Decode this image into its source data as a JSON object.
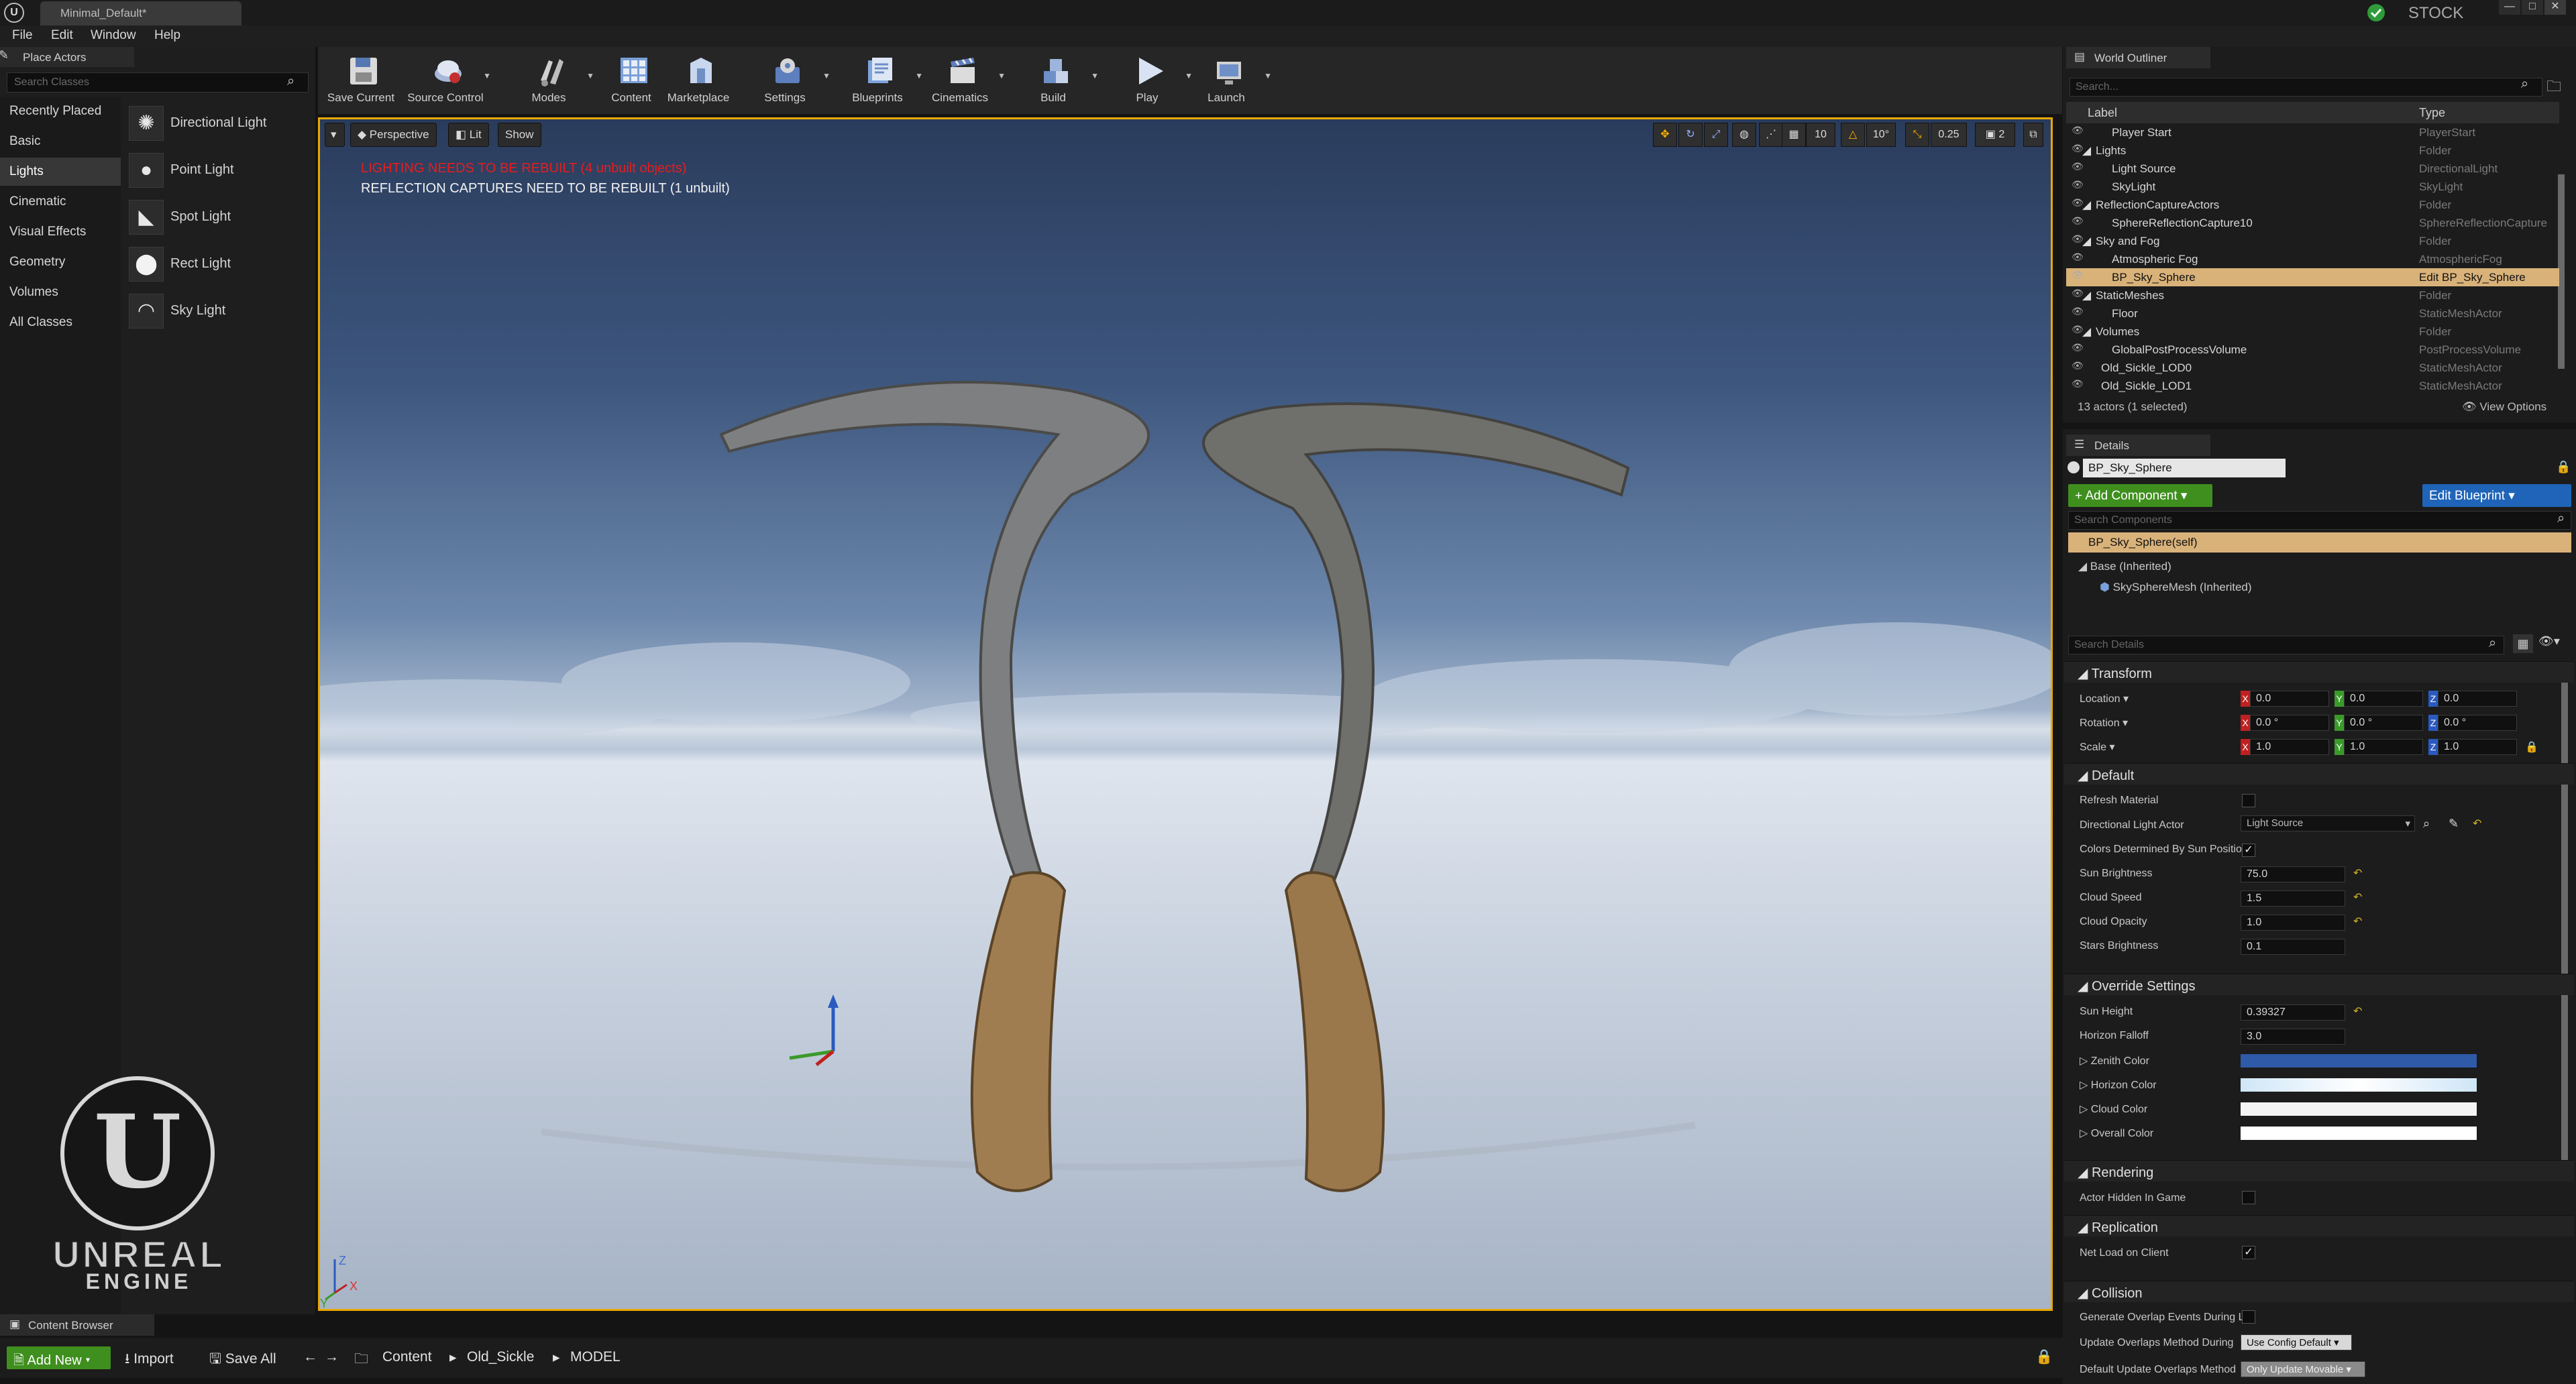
{
  "window": {
    "tab_title": "Minimal_Default*",
    "stock_label": "STOCK",
    "controls": [
      "—",
      "□",
      "✕"
    ]
  },
  "menu": [
    "File",
    "Edit",
    "Window",
    "Help"
  ],
  "place_actors": {
    "tab_label": "Place Actors",
    "search_placeholder": "Search Classes",
    "categories": [
      "Recently Placed",
      "Basic",
      "Lights",
      "Cinematic",
      "Visual Effects",
      "Geometry",
      "Volumes",
      "All Classes"
    ],
    "active_category": "Lights",
    "items": [
      {
        "label": "Directional Light",
        "icon": "sun-icon"
      },
      {
        "label": "Point Light",
        "icon": "bulb-icon"
      },
      {
        "label": "Spot Light",
        "icon": "spotlight-icon"
      },
      {
        "label": "Rect Light",
        "icon": "rect-light-icon"
      },
      {
        "label": "Sky Light",
        "icon": "sky-light-icon"
      }
    ]
  },
  "toolbar": {
    "buttons": [
      {
        "label": "Save Current",
        "icon": "save-icon"
      },
      {
        "label": "Source Control",
        "icon": "source-control-icon"
      },
      {
        "label": "Modes",
        "icon": "modes-icon"
      },
      {
        "label": "Content",
        "icon": "content-icon"
      },
      {
        "label": "Marketplace",
        "icon": "marketplace-icon"
      },
      {
        "label": "Settings",
        "icon": "settings-icon"
      },
      {
        "label": "Blueprints",
        "icon": "blueprints-icon"
      },
      {
        "label": "Cinematics",
        "icon": "cinematics-icon"
      },
      {
        "label": "Build",
        "icon": "build-icon"
      },
      {
        "label": "Play",
        "icon": "play-icon"
      },
      {
        "label": "Launch",
        "icon": "launch-icon"
      }
    ]
  },
  "viewport": {
    "perspective_label": "Perspective",
    "lit_label": "Lit",
    "show_label": "Show",
    "grid_snap": "10",
    "rot_snap": "10°",
    "scale_snap": "0.25",
    "camera_speed": "2",
    "warning_lighting": "LIGHTING NEEDS TO BE REBUILT (4 unbuilt objects)",
    "warning_reflection": "REFLECTION CAPTURES NEED TO BE REBUILT (1 unbuilt)",
    "axis_labels": {
      "z": "Z",
      "x": "X",
      "y": "Y"
    },
    "colors": {
      "highlight": "#e8a800",
      "sky_top": "#2a3c5c",
      "sky_bottom": "#dfe5ee"
    }
  },
  "logo": {
    "line1": "UNREAL",
    "line2": "ENGINE"
  },
  "world_outliner": {
    "tab_label": "World Outliner",
    "search_placeholder": "Search...",
    "col_label": "Label",
    "col_type": "Type",
    "rows": [
      {
        "label": "Player Start",
        "type": "PlayerStart",
        "kind": "actor"
      },
      {
        "label": "Lights",
        "type": "Folder",
        "kind": "folder"
      },
      {
        "label": "Light Source",
        "type": "DirectionalLight",
        "kind": "actor"
      },
      {
        "label": "SkyLight",
        "type": "SkyLight",
        "kind": "actor"
      },
      {
        "label": "ReflectionCaptureActors",
        "type": "Folder",
        "kind": "folder"
      },
      {
        "label": "SphereReflectionCapture10",
        "type": "SphereReflectionCapture",
        "kind": "actor"
      },
      {
        "label": "Sky and Fog",
        "type": "Folder",
        "kind": "folder"
      },
      {
        "label": "Atmospheric Fog",
        "type": "AtmosphericFog",
        "kind": "actor"
      },
      {
        "label": "BP_Sky_Sphere",
        "type": "Edit BP_Sky_Sphere",
        "kind": "actor",
        "selected": true
      },
      {
        "label": "StaticMeshes",
        "type": "Folder",
        "kind": "folder"
      },
      {
        "label": "Floor",
        "type": "StaticMeshActor",
        "kind": "actor"
      },
      {
        "label": "Volumes",
        "type": "Folder",
        "kind": "folder"
      },
      {
        "label": "GlobalPostProcessVolume",
        "type": "PostProcessVolume",
        "kind": "actor"
      },
      {
        "label": "Old_Sickle_LOD0",
        "type": "StaticMeshActor",
        "kind": "root"
      },
      {
        "label": "Old_Sickle_LOD1",
        "type": "StaticMeshActor",
        "kind": "root"
      }
    ],
    "count_text": "13 actors (1 selected)",
    "view_options": "View Options"
  },
  "details": {
    "tab_label": "Details",
    "actor_name": "BP_Sky_Sphere",
    "add_component": "+ Add Component ▾",
    "edit_blueprint": "Edit Blueprint ▾",
    "search_components": "Search Components",
    "self_component": "BP_Sky_Sphere(self)",
    "base_component": "Base (Inherited)",
    "sky_mesh_component": "SkySphereMesh (Inherited)",
    "search_details": "Search Details",
    "transform": {
      "title": "Transform",
      "location_label": "Location",
      "rotation_label": "Rotation",
      "scale_label": "Scale",
      "location": [
        "0.0",
        "0.0",
        "0.0"
      ],
      "rotation": [
        "0.0 °",
        "0.0 °",
        "0.0 °"
      ],
      "scale": [
        "1.0",
        "1.0",
        "1.0"
      ]
    },
    "default": {
      "title": "Default",
      "refresh_material": "Refresh Material",
      "directional_light_actor": "Directional Light Actor",
      "directional_light_value": "Light Source",
      "colors_by_sun": "Colors Determined By Sun Positio",
      "sun_brightness": "Sun Brightness",
      "sun_brightness_value": "75.0",
      "cloud_speed": "Cloud Speed",
      "cloud_speed_value": "1.5",
      "cloud_opacity": "Cloud Opacity",
      "cloud_opacity_value": "1.0",
      "stars_brightness": "Stars Brightness",
      "stars_brightness_value": "0.1"
    },
    "override": {
      "title": "Override Settings",
      "sun_height": "Sun Height",
      "sun_height_value": "0.39327",
      "horizon_falloff": "Horizon Falloff",
      "horizon_falloff_value": "3.0",
      "zenith_color": "Zenith Color",
      "horizon_color": "Horizon Color",
      "cloud_color": "Cloud Color",
      "overall_color": "Overall Color",
      "zenith_hex": "#2e5aa8",
      "horizon_hex": "#cfe6f7",
      "cloud_hex": "#f4f4f4",
      "overall_hex": "#ffffff"
    },
    "rendering": {
      "title": "Rendering",
      "actor_hidden": "Actor Hidden In Game"
    },
    "replication": {
      "title": "Replication",
      "net_load": "Net Load on Client"
    },
    "collision": {
      "title": "Collision",
      "gen_overlap": "Generate Overlap Events During L",
      "update_overlaps": "Update Overlaps Method During",
      "update_overlaps_value": "Use Config Default",
      "default_update": "Default Update Overlaps Method",
      "default_update_value": "Only Update Movable"
    }
  },
  "content_browser": {
    "tab_label": "Content Browser",
    "add_new": "Add New",
    "import": "Import",
    "save_all": "Save All",
    "path": [
      "Content",
      "Old_Sickle",
      "MODEL"
    ]
  }
}
